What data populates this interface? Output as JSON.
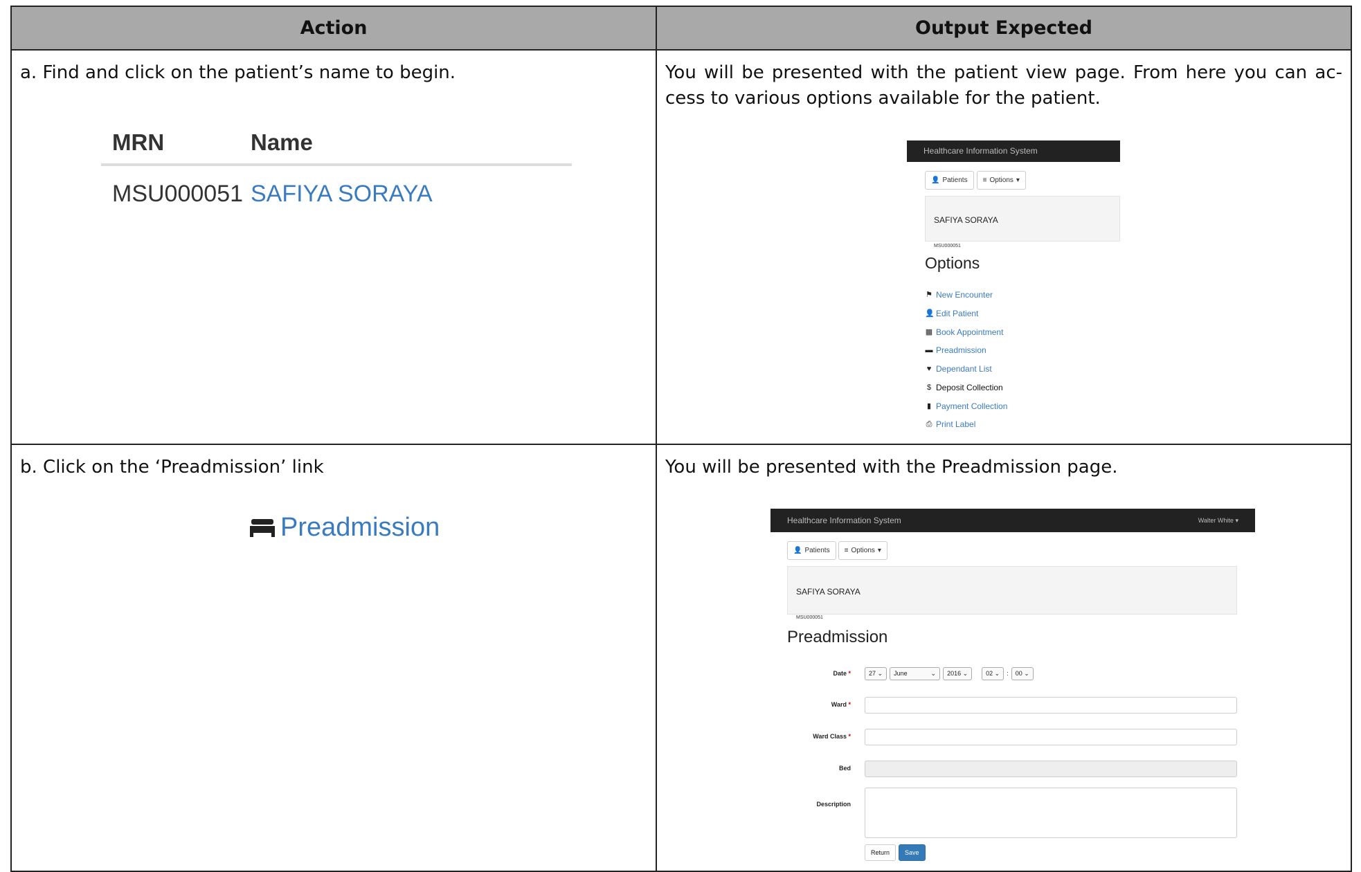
{
  "table": {
    "headers": {
      "action": "Action",
      "output": "Output Expected"
    },
    "rows": [
      {
        "action": "a. Find and click on the patient’s name to begin.",
        "output": "You will be presented with the patient view page. From here you can ac-cess to various options available for the patient."
      },
      {
        "action": "b. Click on the ‘Preadmission’ link",
        "output": "You will be presented with the Preadmission page."
      }
    ]
  },
  "mrn_snippet": {
    "col_mrn": "MRN",
    "col_name": "Name",
    "mrn": "MSU000051",
    "name": "SAFIYA SORAYA"
  },
  "preadmission_link": {
    "label": "Preadmission",
    "icon": "bed-icon"
  },
  "shot_patient_view": {
    "app_title": "Healthcare Information System",
    "patients_button": "Patients",
    "options_button": "Options",
    "patient_name": "SAFIYA SORAYA",
    "patient_mrn": "MSU000051",
    "options_title": "Options",
    "options": [
      {
        "label": "New Encounter",
        "icon": "flag-icon"
      },
      {
        "label": "Edit Patient",
        "icon": "user-icon"
      },
      {
        "label": "Book Appointment",
        "icon": "calendar-icon"
      },
      {
        "label": "Preadmission",
        "icon": "bed-icon"
      },
      {
        "label": "Dependant List",
        "icon": "heart-icon"
      },
      {
        "label": "Deposit Collection",
        "icon": "dollar-icon"
      },
      {
        "label": "Payment Collection",
        "icon": "book-icon"
      },
      {
        "label": "Print Label",
        "icon": "print-icon"
      }
    ]
  },
  "shot_preadmission": {
    "app_title": "Healthcare Information System",
    "user_menu": "Walter White",
    "patients_button": "Patients",
    "options_button": "Options",
    "patient_name": "SAFIYA SORAYA",
    "patient_mrn": "MSU000051",
    "page_title": "Preadmission",
    "labels": {
      "date": "Date",
      "ward": "Ward",
      "ward_class": "Ward Class",
      "bed": "Bed",
      "description": "Description"
    },
    "date": {
      "day": "27",
      "month": "June",
      "year": "2016",
      "hour": "02",
      "minute": "00"
    },
    "return_button": "Return",
    "save_button": "Save"
  }
}
